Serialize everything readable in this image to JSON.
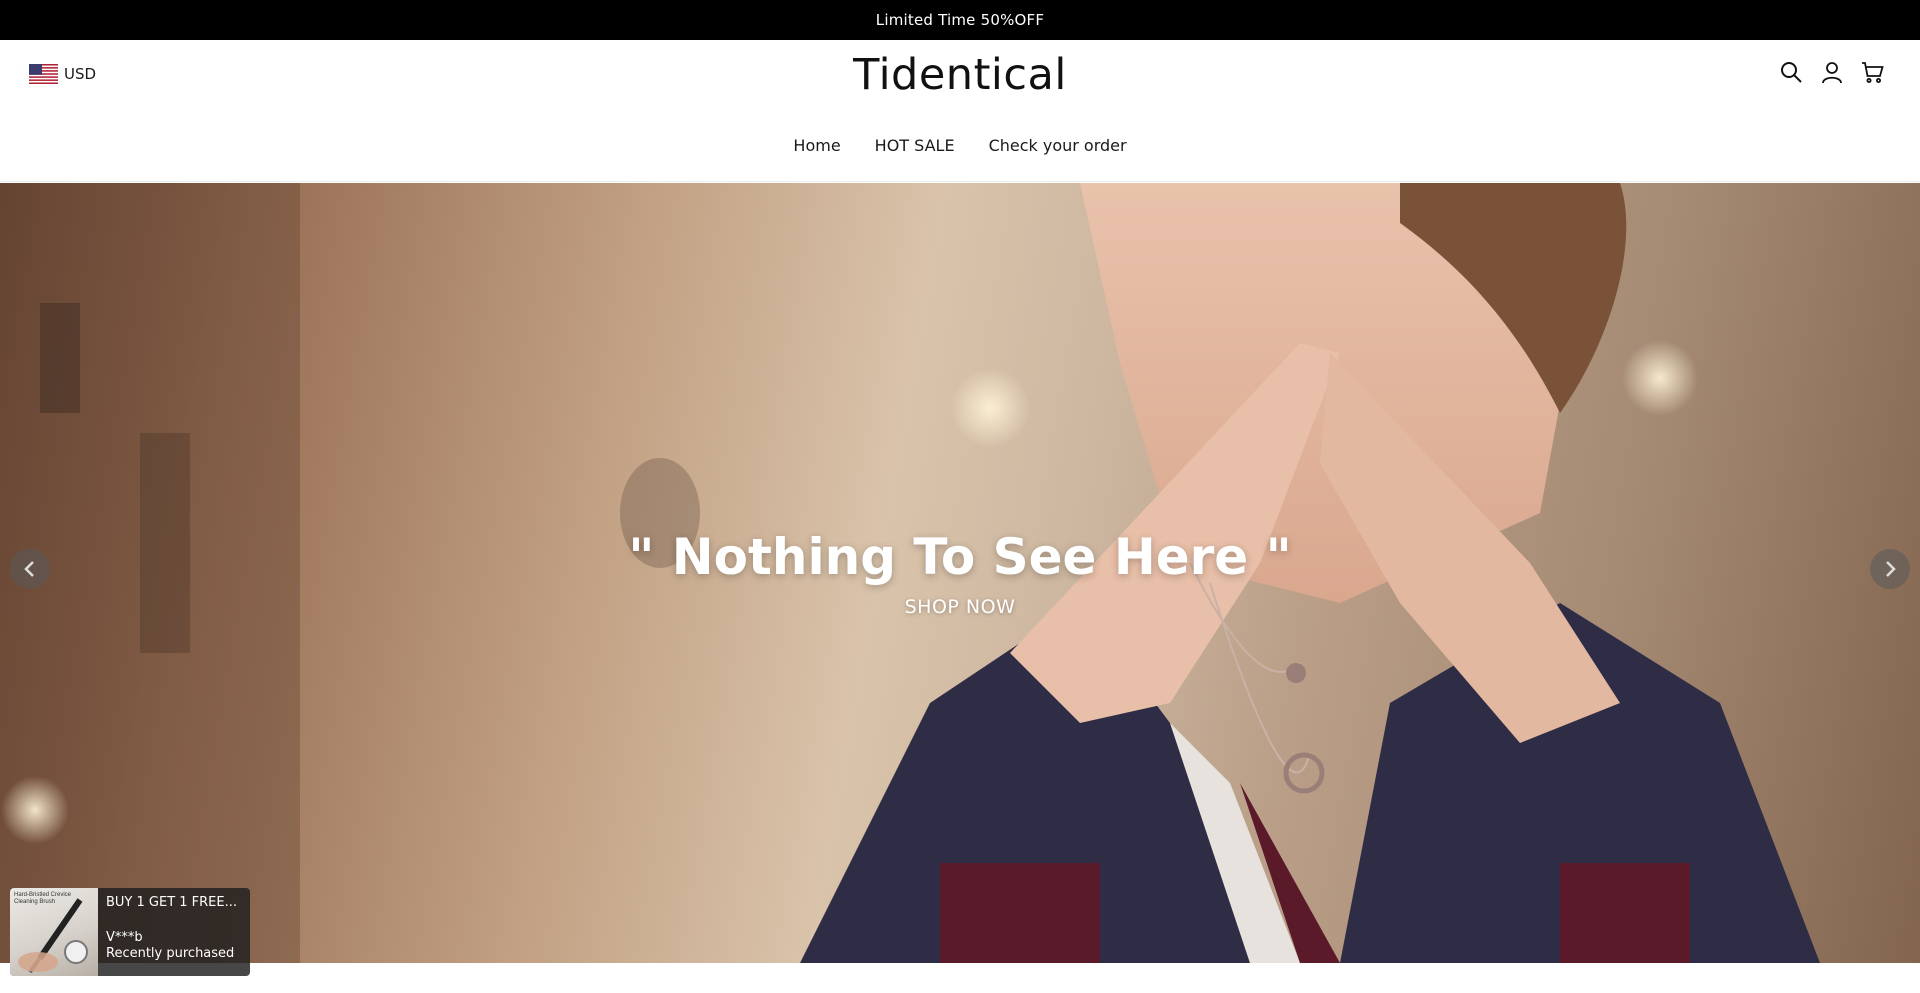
{
  "announcement": {
    "text": "Limited Time 50%OFF"
  },
  "header": {
    "currency": "USD",
    "brand": "Tidentical",
    "icons": {
      "search": "search-icon",
      "account": "user-icon",
      "cart": "cart-icon"
    }
  },
  "nav": {
    "items": [
      {
        "label": "Home"
      },
      {
        "label": "HOT SALE"
      },
      {
        "label": "Check your order"
      }
    ]
  },
  "hero": {
    "title": "\" Nothing To See Here \"",
    "cta": "SHOP NOW"
  },
  "toast": {
    "title": "BUY 1 GET 1 FREE...",
    "customer": "V***b",
    "status": "Recently purchased",
    "thumb_label": "Hard-Bristled Crevice Cleaning Brush"
  },
  "colors": {
    "announcement_bg": "#000000",
    "header_bg": "#ffffff",
    "text": "#1a1a1a"
  }
}
